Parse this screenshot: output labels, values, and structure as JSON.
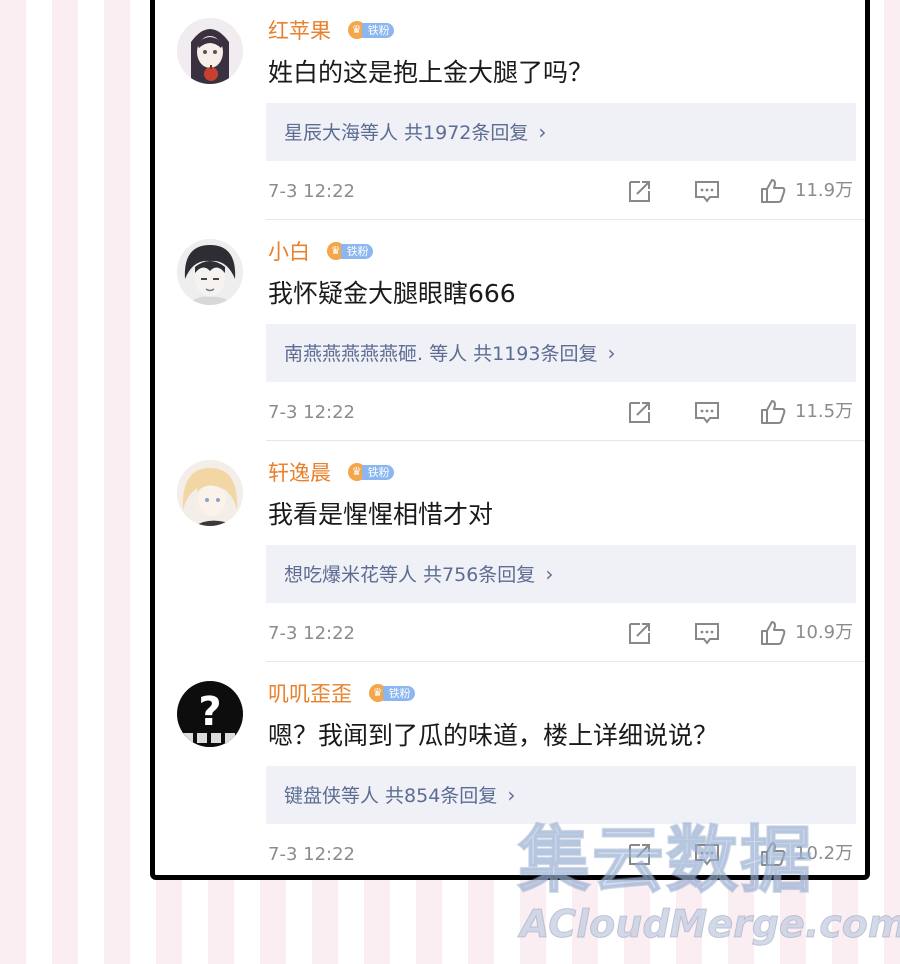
{
  "comments": [
    {
      "username": "红苹果",
      "badge": "铁粉",
      "text": "姓白的这是抱上金大腿了吗？",
      "replies_text": "星辰大海等人  共1972条回复",
      "time": "7-3 12:22",
      "likes": "11.9万",
      "avatar": "anime-girl-with-apple"
    },
    {
      "username": "小白",
      "badge": "铁粉",
      "text": "我怀疑金大腿眼瞎666",
      "replies_text": "南燕燕燕燕燕砸. 等人  共1193条回复",
      "time": "7-3 12:22",
      "likes": "11.5万",
      "avatar": "anime-boy-dark-hair"
    },
    {
      "username": "轩逸晨",
      "badge": "铁粉",
      "text": "我看是惺惺相惜才对",
      "replies_text": "想吃爆米花等人  共756条回复",
      "time": "7-3 12:22",
      "likes": "10.9万",
      "avatar": "anime-blond-character"
    },
    {
      "username": "叽叽歪歪",
      "badge": "铁粉",
      "text": "嗯？我闻到了瓜的味道，楼上详细说说？",
      "replies_text": "键盘侠等人  共854条回复",
      "time": "7-3 12:22",
      "likes": "10.2万",
      "avatar": "question-mark-black"
    }
  ],
  "icons": {
    "share": "share-icon",
    "comment": "comment-icon",
    "like": "thumbs-up-icon",
    "chevron": "chevron-right-icon"
  },
  "colors": {
    "username": "#e8802c",
    "reply_link": "#5c6c92",
    "reply_bg": "#f0f1f7",
    "badge": "#8bb6f0",
    "meta": "#8c8c8c"
  },
  "watermark": {
    "cn": "集云数据",
    "en": "ACloudMerge.com"
  }
}
